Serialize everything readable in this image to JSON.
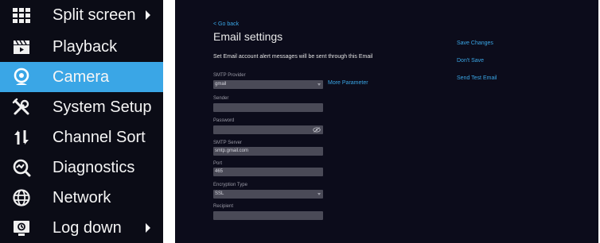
{
  "menu": {
    "items": [
      {
        "label": "Split screen",
        "icon": "grid-icon",
        "has_submenu": true,
        "active": false
      },
      {
        "label": "Playback",
        "icon": "clapperboard-icon",
        "has_submenu": false,
        "active": false
      },
      {
        "label": "Camera",
        "icon": "webcam-icon",
        "has_submenu": false,
        "active": true
      },
      {
        "label": "System Setup",
        "icon": "tools-icon",
        "has_submenu": false,
        "active": false
      },
      {
        "label": "Channel Sort",
        "icon": "sort-arrows-icon",
        "has_submenu": false,
        "active": false
      },
      {
        "label": "Diagnostics",
        "icon": "diagnostics-icon",
        "has_submenu": false,
        "active": false
      },
      {
        "label": "Network",
        "icon": "globe-icon",
        "has_submenu": false,
        "active": false
      },
      {
        "label": "Log down",
        "icon": "log-monitor-icon",
        "has_submenu": true,
        "active": false
      }
    ]
  },
  "settings": {
    "go_back": "< Go back",
    "title": "Email settings",
    "subtitle": "Set Email account alert messages will be sent through this Email",
    "actions": {
      "save_changes": "Save Changes",
      "dont_save": "Don't Save",
      "send_test_email": "Send Test Email"
    },
    "more_parameter": "More Parameter",
    "fields": {
      "smtp_provider": {
        "label": "SMTP Provider",
        "value": "gmail"
      },
      "sender": {
        "label": "Sender",
        "value": ""
      },
      "password": {
        "label": "Password",
        "value": ""
      },
      "smtp_server": {
        "label": "SMTP Server",
        "value": "smtp.gmail.com"
      },
      "port": {
        "label": "Port",
        "value": "465"
      },
      "encryption_type": {
        "label": "Encryption Type",
        "value": "SSL"
      },
      "recipient": {
        "label": "Recipient",
        "value": ""
      }
    }
  },
  "colors": {
    "accent": "#3aa6e6",
    "menu_background": "#0b0c16",
    "settings_background": "#0c0c1b",
    "field_background": "#4a4a57"
  }
}
